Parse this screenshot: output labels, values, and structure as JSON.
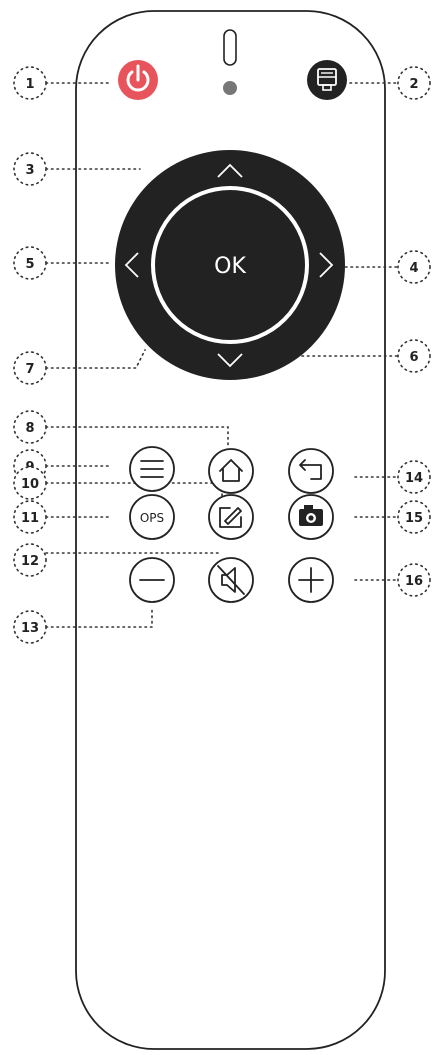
{
  "ok_label": "OK",
  "ops_label": "OPS",
  "power_color": "#e8545c",
  "body_color": "#222222",
  "callouts": [
    "1",
    "2",
    "3",
    "4",
    "5",
    "6",
    "7",
    "8",
    "9",
    "10",
    "11",
    "12",
    "13",
    "14",
    "15",
    "16"
  ],
  "buttons": {
    "power": "power-icon",
    "input": "input-source-icon",
    "menu": "menu-icon",
    "home": "home-icon",
    "back": "back-icon",
    "annotate": "annotate-icon",
    "screenshot": "camera-icon",
    "volume_down": "minus-icon",
    "mute": "mute-icon",
    "volume_up": "plus-icon",
    "up": "chevron-up-icon",
    "down": "chevron-down-icon",
    "left": "chevron-left-icon",
    "right": "chevron-right-icon"
  }
}
